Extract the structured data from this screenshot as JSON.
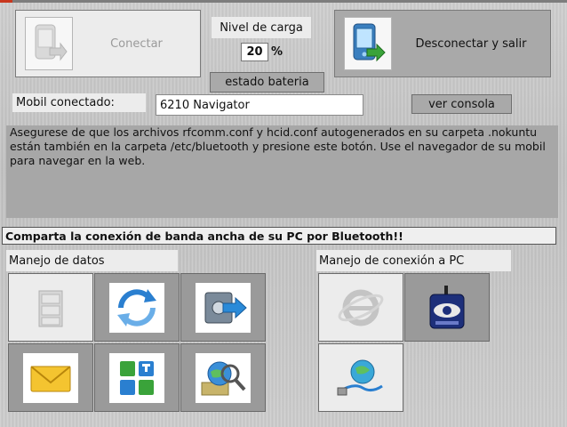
{
  "header": {
    "connect_label": "Conectar",
    "disconnect_label": "Desconectar y salir",
    "charge_label": "Nivel de carga",
    "charge_value": "20",
    "charge_unit": "%",
    "battery_button": "estado bateria"
  },
  "mobile": {
    "label": "Mobil conectado:",
    "value": "6210 Navigator",
    "console_button": "ver consola"
  },
  "info": {
    "message": "Asegurese de que los archivos rfcomm.conf y hcid.conf autogenerados en su carpeta .nokuntu están también en la carpeta /etc/bluetooth y presione este botón. Use el navegador de su mobil para navegar en la web."
  },
  "banner": {
    "text": "Comparta la conexión de banda ancha de su PC por Bluetooth!!"
  },
  "sections": {
    "data_label": "Manejo de datos",
    "pc_label": "Manejo de conexión a PC"
  },
  "icons": {
    "connect": "phone-connect-icon",
    "disconnect": "phone-disconnect-icon",
    "data_tiles": [
      "file-cabinet-icon",
      "sync-icon",
      "backup-transfer-icon",
      "messages-envelope-icon",
      "apps-grid-icon",
      "web-search-icon"
    ],
    "pc_tiles": [
      "internet-explorer-icon",
      "phone-modem-icon",
      "usb-network-icon"
    ]
  },
  "colors": {
    "background": "#c8c8c8",
    "button_light": "#ececec",
    "button_dark": "#a9a9a9",
    "accent_blue": "#2a7fd0",
    "accent_green": "#3aa33a"
  }
}
